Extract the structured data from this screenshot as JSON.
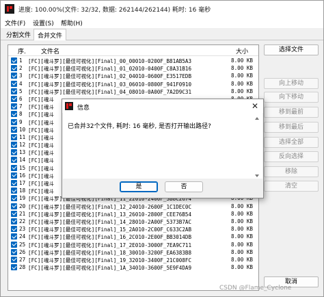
{
  "window": {
    "title": "进度: 100.00%(文件: 32/32, 数据: 262144/262144) 耗时: 16 毫秒"
  },
  "menu": [
    "文件(F)",
    "设置(S)",
    "帮助(H)"
  ],
  "tabs": [
    "分割文件",
    "合并文件"
  ],
  "list": {
    "headers": {
      "index": "序.",
      "name": "文件名",
      "size": "大小"
    },
    "rows": [
      {
        "n": "1",
        "name": "[FC][魂斗罗][最佳可视化][Final]_00_00010-0200F_B81AB5A3",
        "size": "8.00 KB"
      },
      {
        "n": "2",
        "name": "[FC][魂斗罗][最佳可视化][Final]_01_02010-0400F_C8A31B16",
        "size": "8.00 KB"
      },
      {
        "n": "3",
        "name": "[FC][魂斗罗][最佳可视化][Final]_02_04010-0600F_E3517EDB",
        "size": "8.00 KB"
      },
      {
        "n": "4",
        "name": "[FC][魂斗罗][最佳可视化][Final]_03_06010-0800F_941F0910",
        "size": "8.00 KB"
      },
      {
        "n": "5",
        "name": "[FC][魂斗罗][最佳可视化][Final]_04_08010-0A00F_7A2D9C31",
        "size": "8.00 KB"
      },
      {
        "n": "6",
        "name": "[FC][魂斗",
        "size": "8.00 KB"
      },
      {
        "n": "7",
        "name": "[FC][魂斗",
        "size": "8.00 KB"
      },
      {
        "n": "8",
        "name": "[FC][魂斗",
        "size": "8.00 KB"
      },
      {
        "n": "9",
        "name": "[FC][魂斗",
        "size": "8.00 KB"
      },
      {
        "n": "10",
        "name": "[FC][魂斗",
        "size": "8.00 KB"
      },
      {
        "n": "11",
        "name": "[FC][魂斗",
        "size": "8.00 KB"
      },
      {
        "n": "12",
        "name": "[FC][魂斗",
        "size": "8.00 KB"
      },
      {
        "n": "13",
        "name": "[FC][魂斗",
        "size": "8.00 KB"
      },
      {
        "n": "14",
        "name": "[FC][魂斗",
        "size": "8.00 KB"
      },
      {
        "n": "15",
        "name": "[FC][魂斗",
        "size": "8.00 KB"
      },
      {
        "n": "16",
        "name": "[FC][魂斗",
        "size": "8.00 KB"
      },
      {
        "n": "17",
        "name": "[FC][魂斗",
        "size": "8.00 KB"
      },
      {
        "n": "18",
        "name": "[FC][魂斗",
        "size": "8.00 KB"
      },
      {
        "n": "19",
        "name": "[FC][魂斗罗][最佳可视化][Final]_11_22010-2400F_3B8C2674",
        "size": "8.00 KB"
      },
      {
        "n": "20",
        "name": "[FC][魂斗罗][最佳可视化][Final]_12_24010-2600F_1C1DEC0C",
        "size": "8.00 KB"
      },
      {
        "n": "21",
        "name": "[FC][魂斗罗][最佳可视化][Final]_13_26010-2800F_CEE76B54",
        "size": "8.00 KB"
      },
      {
        "n": "22",
        "name": "[FC][魂斗罗][最佳可视化][Final]_14_28010-2A00F_5373B7AC",
        "size": "8.00 KB"
      },
      {
        "n": "23",
        "name": "[FC][魂斗罗][最佳可视化][Final]_15_2A010-2C00F_C633C2AB",
        "size": "8.00 KB"
      },
      {
        "n": "24",
        "name": "[FC][魂斗罗][最佳可视化][Final]_16_2C010-2E00F_BB3014DB",
        "size": "8.00 KB"
      },
      {
        "n": "25",
        "name": "[FC][魂斗罗][最佳可视化][Final]_17_2E010-3000F_7EA9C711",
        "size": "8.00 KB"
      },
      {
        "n": "26",
        "name": "[FC][魂斗罗][最佳可视化][Final]_18_30010-3200F_EA6383B8",
        "size": "8.00 KB"
      },
      {
        "n": "27",
        "name": "[FC][魂斗罗][最佳可视化][Final]_19_32010-3400F_21C008FC",
        "size": "8.00 KB"
      },
      {
        "n": "28",
        "name": "[FC][魂斗罗][最佳可视化][Final]_1A_34010-3600F_5E9F4DA9",
        "size": "8.00 KB"
      }
    ]
  },
  "side_buttons": {
    "select_files": "选择文件",
    "move_up": "向上移动",
    "move_down": "向下移动",
    "move_top": "移到最前",
    "move_bottom": "移到最后",
    "select_all": "选择全部",
    "invert": "反向选择",
    "remove": "移除",
    "clear": "清空",
    "cancel": "取消"
  },
  "watermark": "CSDN @Flame_Cyclone",
  "dialog": {
    "title": "信息",
    "close": "✕",
    "message": "已合并32个文件, 耗时: 16 毫秒, 是否打开输出路径?",
    "yes": "是",
    "no": "否"
  },
  "colors": {
    "accent": "#0067c0",
    "icon_red": "#e01818"
  },
  "icons": [
    "app-icon",
    "checkbox-checked-icon",
    "close-icon",
    "scroll-up-icon",
    "scroll-down-icon"
  ]
}
